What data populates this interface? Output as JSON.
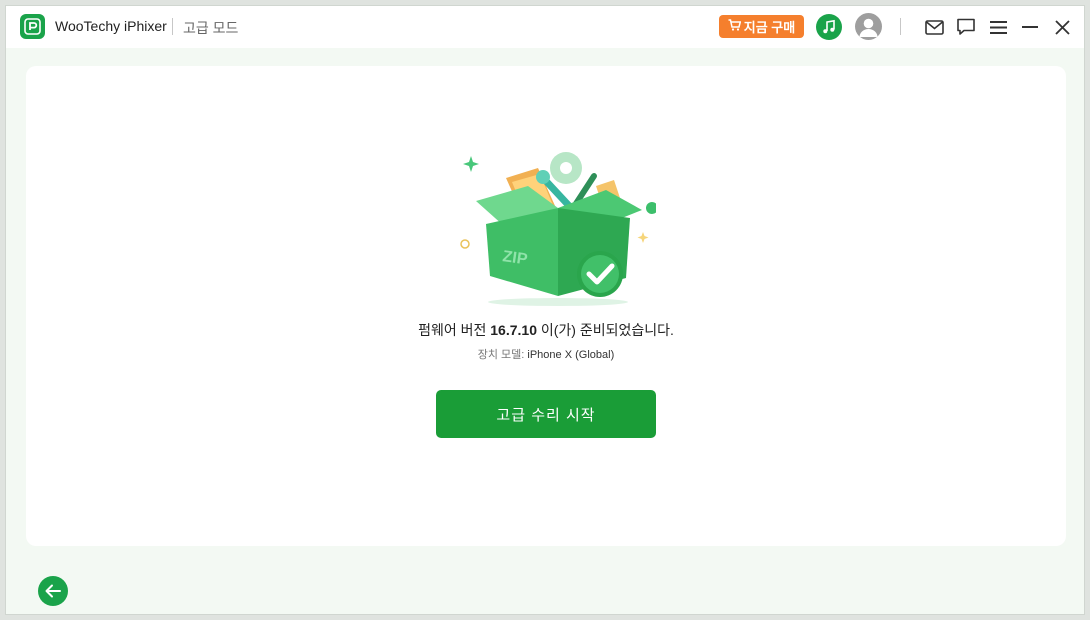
{
  "titlebar": {
    "app_name": "WooTechy iPhixer",
    "mode": "고급 모드",
    "buy_label": "지금 구매",
    "icons": {
      "logo": "app-logo-icon",
      "music": "music-icon",
      "avatar": "user-avatar-icon",
      "mail": "mail-icon",
      "chat": "chat-icon",
      "menu": "menu-icon",
      "minimize": "minimize-icon",
      "close": "close-icon"
    }
  },
  "main": {
    "illustration": "zip-box-check-illustration",
    "ready_prefix": "펌웨어 버전 ",
    "firmware_version": "16.7.10",
    "ready_suffix": " 이(가) 준비되었습니다.",
    "device_label": "장치 모델: ",
    "device_model": "iPhone X (Global)",
    "primary_button": "고급 수리 시작"
  },
  "footer": {
    "back_icon": "back-arrow-icon"
  },
  "colors": {
    "brand_green": "#1aa34a",
    "button_green": "#1a9d37",
    "buy_orange": "#f57f2d",
    "background": "#f3f9f3"
  }
}
